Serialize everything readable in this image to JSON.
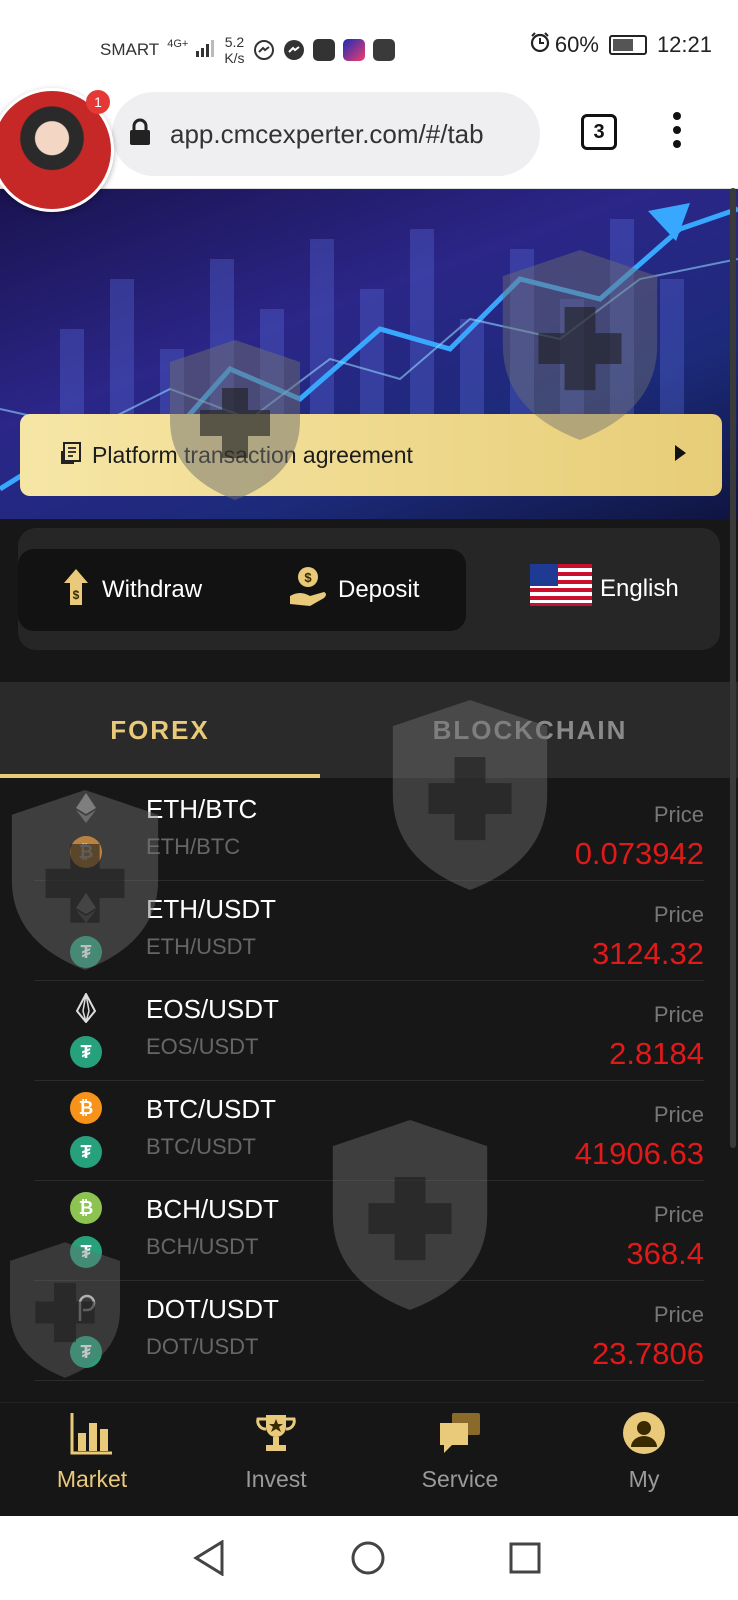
{
  "status_bar": {
    "carrier": "SMART",
    "network": "4G+",
    "speed_value": "5.2",
    "speed_unit": "K/s",
    "battery": "60%",
    "time": "12:21"
  },
  "browser": {
    "url": "app.cmcexperter.com/#/tab",
    "tab_count": "3",
    "chat_head_badge": "1"
  },
  "agreement": {
    "label": "Platform transaction agreement"
  },
  "quick_actions": {
    "withdraw": "Withdraw",
    "deposit": "Deposit",
    "language": "English"
  },
  "market_tabs": {
    "tabs": [
      {
        "label": "FOREX",
        "active": true
      },
      {
        "label": "BLOCKCHAIN",
        "active": false
      }
    ]
  },
  "market": {
    "price_label": "Price",
    "rows": [
      {
        "pair": "ETH/BTC",
        "sub": "ETH/BTC",
        "price": "0.073942",
        "base_icon": "eth-icon",
        "quote_icon": "btc-icon"
      },
      {
        "pair": "ETH/USDT",
        "sub": "ETH/USDT",
        "price": "3124.32",
        "base_icon": "eth-icon",
        "quote_icon": "usdt-icon"
      },
      {
        "pair": "EOS/USDT",
        "sub": "EOS/USDT",
        "price": "2.8184",
        "base_icon": "eos-icon",
        "quote_icon": "usdt-icon"
      },
      {
        "pair": "BTC/USDT",
        "sub": "BTC/USDT",
        "price": "41906.63",
        "base_icon": "btc-icon",
        "quote_icon": "usdt-icon"
      },
      {
        "pair": "BCH/USDT",
        "sub": "BCH/USDT",
        "price": "368.4",
        "base_icon": "bch-icon",
        "quote_icon": "usdt-icon"
      },
      {
        "pair": "DOT/USDT",
        "sub": "DOT/USDT",
        "price": "23.7806",
        "base_icon": "dot-icon",
        "quote_icon": "usdt-icon"
      }
    ]
  },
  "bottom_nav": {
    "items": [
      {
        "label": "Market",
        "icon": "bar-chart-icon",
        "active": true
      },
      {
        "label": "Invest",
        "icon": "trophy-icon",
        "active": false
      },
      {
        "label": "Service",
        "icon": "chat-icon",
        "active": false
      },
      {
        "label": "My",
        "icon": "user-icon",
        "active": false
      }
    ]
  },
  "colors": {
    "accent_gold": "#e9c97a",
    "price_red": "#e01919",
    "background": "#171717"
  }
}
